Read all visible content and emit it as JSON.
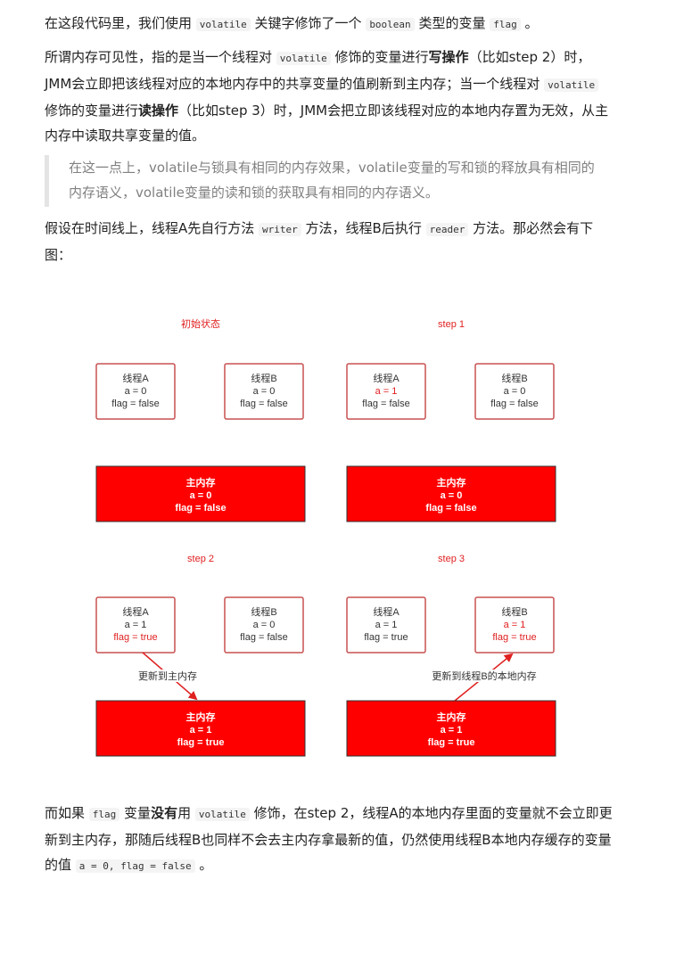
{
  "para1": {
    "t1": "在这段代码里，我们使用 ",
    "c1": "volatile",
    "t2": " 关键字修饰了一个 ",
    "c2": "boolean",
    "t3": " 类型的变量 ",
    "c3": "flag",
    "t4": " 。"
  },
  "para2": {
    "t1": "所谓内存可见性，指的是当一个线程对 ",
    "c1": "volatile",
    "t2": " 修饰的变量进行",
    "b1": "写操作",
    "t3": "（比如step 2）时，JMM会立即把该线程对应的本地内存中的共享变量的值刷新到主内存；当一个线程对 ",
    "c2": "volatile",
    "t4": " 修饰的变量进行",
    "b2": "读操作",
    "t5": "（比如step 3）时，JMM会把立即该线程对应的本地内存置为无效，从主内存中读取共享变量的值。"
  },
  "quote": "在这一点上，volatile与锁具有相同的内存效果，volatile变量的写和锁的释放具有相同的内存语义，volatile变量的读和锁的获取具有相同的内存语义。",
  "para3": {
    "t1": "假设在时间线上，线程A先自行方法 ",
    "c1": "writer",
    "t2": " 方法，线程B后执行 ",
    "c2": "reader",
    "t3": " 方法。那必然会有下图："
  },
  "diagram": {
    "panels": [
      {
        "title": "初始状态",
        "thread_a": {
          "name": "线程A",
          "a": "a = 0",
          "flag": "flag = false"
        },
        "thread_b": {
          "name": "线程B",
          "a": "a = 0",
          "flag": "flag = false"
        },
        "main": {
          "name": "主内存",
          "a": "a = 0",
          "flag": "flag = false"
        }
      },
      {
        "title": "step 1",
        "thread_a": {
          "name": "线程A",
          "a": "a = 1",
          "flag": "flag = false"
        },
        "thread_b": {
          "name": "线程B",
          "a": "a = 0",
          "flag": "flag = false"
        },
        "main": {
          "name": "主内存",
          "a": "a = 0",
          "flag": "flag = false"
        }
      },
      {
        "title": "step 2",
        "thread_a": {
          "name": "线程A",
          "a": "a = 1",
          "flag": "flag = true"
        },
        "thread_b": {
          "name": "线程B",
          "a": "a = 0",
          "flag": "flag = false"
        },
        "main": {
          "name": "主内存",
          "a": "a = 1",
          "flag": "flag = true"
        },
        "arrow_label": "更新到主内存"
      },
      {
        "title": "step 3",
        "thread_a": {
          "name": "线程A",
          "a": "a = 1",
          "flag": "flag = true"
        },
        "thread_b": {
          "name": "线程B",
          "a": "a = 1",
          "flag": "flag = true"
        },
        "main": {
          "name": "主内存",
          "a": "a = 1",
          "flag": "flag = true"
        },
        "arrow_label": "更新到线程B的本地内存"
      }
    ],
    "colors": {
      "accent": "#e02020",
      "main_fill": "#ff0000",
      "box_border": "#c85050"
    }
  },
  "para4": {
    "t1": "而如果 ",
    "c1": "flag",
    "t2": " 变量",
    "b1": "没有",
    "t3": "用 ",
    "c2": "volatile",
    "t4": " 修饰，在step 2，线程A的本地内存里面的变量就不会立即更新到主内存，那随后线程B也同样不会去主内存拿最新的值，仍然使用线程B本地内存缓存的变量的值 ",
    "c3": "a = 0, flag = false",
    "t5": " 。"
  }
}
